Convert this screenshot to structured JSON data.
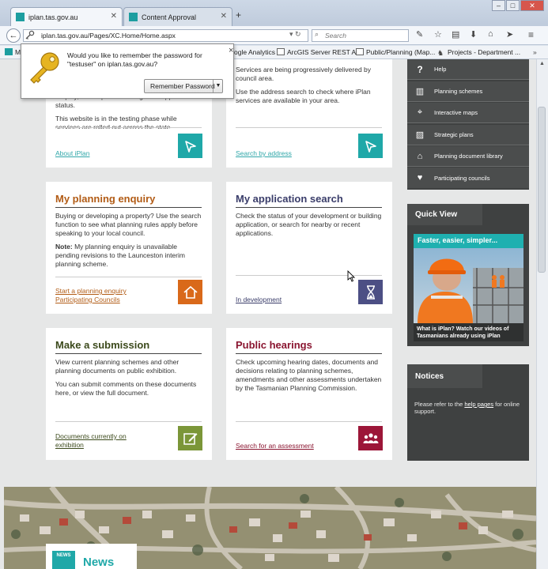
{
  "browser": {
    "tabs": [
      {
        "title": "iplan.tas.gov.au",
        "active": true
      },
      {
        "title": "Content Approval",
        "active": false
      }
    ],
    "new_tab": "+",
    "window_controls": [
      "–",
      "□",
      "✕"
    ],
    "url": "iplan.tas.gov.au/Pages/XC.Home/Home.aspx",
    "search_placeholder": "Search",
    "bookmarks_partial": "M",
    "bookmarks": [
      "ogle Analytics",
      "ArcGIS Server REST API",
      "Public/Planning (Map...",
      "Projects - Department ..."
    ]
  },
  "password_popup": {
    "message": "Would you like to remember the password for \"testuser\" on iplan.tas.gov.au?",
    "button": "Remember Password",
    "close": "×"
  },
  "cards": {
    "about": {
      "body_partial": "enquiry, attend public hearings and application status.",
      "body2": "This website is in the testing phase while services are rolled out across the state.",
      "link": "About iPlan"
    },
    "search": {
      "body1": "Services are being progressively delivered by council area.",
      "body2": "Use the address search to check where iPlan services are available in your area.",
      "link": "Search by address"
    },
    "enquiry": {
      "title": "My planning enquiry",
      "body1": "Buying or developing a property? Use the search function to see what planning rules apply before speaking to your local council.",
      "note_label": "Note:",
      "note": " My planning enquiry is unavailable pending revisions to the Launceston interim planning scheme.",
      "link1": "Start a planning enquiry",
      "link2": "Participating Councils"
    },
    "application": {
      "title": "My application search",
      "body1": "Check the status of your development or building application, or search for nearby or recent applications.",
      "link": "In development"
    },
    "submission": {
      "title": "Make a submission",
      "body1": "View current planning schemes and other planning documents on public exhibition.",
      "body2": "You can submit comments on these documents here, or view the full document.",
      "link": "Documents currently on exhibition"
    },
    "hearings": {
      "title": "Public hearings",
      "body1": "Check upcoming hearing dates, documents and decisions relating to planning schemes, amendments and other assessments undertaken by the Tasmanian Planning Commission.",
      "link": "Search for an assessment"
    }
  },
  "sidebar": {
    "items": [
      {
        "label": "Help",
        "icon": "question-icon"
      },
      {
        "label": "Planning schemes",
        "icon": "book-icon"
      },
      {
        "label": "Interactive maps",
        "icon": "map-pin-icon"
      },
      {
        "label": "Strategic plans",
        "icon": "map-icon"
      },
      {
        "label": "Planning document library",
        "icon": "library-icon"
      },
      {
        "label": "Participating councils",
        "icon": "tasmania-icon"
      }
    ],
    "quick_view": {
      "title": "Quick View",
      "banner": "Faster, easier, simpler...",
      "caption": "What is iPlan? Watch our videos of Tasmanians already using iPlan"
    },
    "notices": {
      "title": "Notices",
      "text_before": "Please refer to the ",
      "link": "help pages",
      "text_after": " for online support."
    }
  },
  "news": {
    "title": "News",
    "icon_label": "NEWS"
  },
  "colors": {
    "teal": "#1fa8a8",
    "orange": "#d9691a",
    "purple": "#4c4f84",
    "olive": "#7b9638",
    "maroon": "#9c1638",
    "enquiry_title": "#b25c16",
    "application_title": "#3a3d6a",
    "submission_title": "#3c4a1c",
    "hearings_title": "#8a1530",
    "sidebar_dark": "#4b4d4d"
  }
}
